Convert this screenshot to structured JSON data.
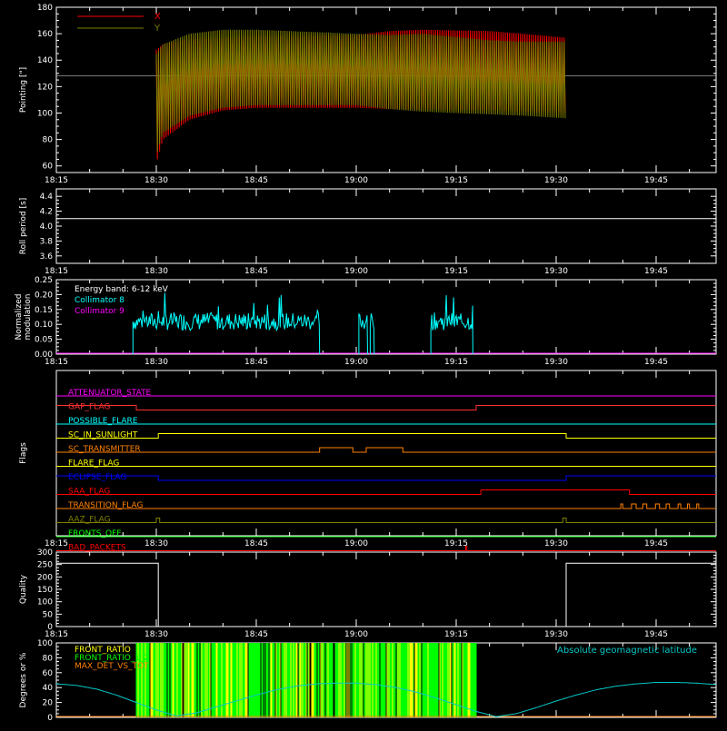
{
  "time_axis": {
    "ticks": [
      "18:15",
      "18:30",
      "18:45",
      "19:00",
      "19:15",
      "19:30",
      "19:45"
    ],
    "tick_minutes": [
      1095,
      1110,
      1125,
      1140,
      1155,
      1170,
      1185
    ],
    "range_minutes": [
      1095,
      1194
    ]
  },
  "colors": {
    "background": "#000000",
    "axes": "#ffffff",
    "x_series": "#ff0000",
    "y_series": "#808000",
    "collimator8": "#00ffff",
    "collimator9": "#ff00ff",
    "quality": "#ffffff",
    "front_ratio": "#ffff00",
    "front_ratio_2": "#00ff00",
    "max_det": "#ff8000",
    "geomag": "#00c8c8"
  },
  "chart_data": [
    {
      "type": "line",
      "id": "pointing",
      "ylabel": "Pointing [\"]",
      "ylim": [
        55,
        180
      ],
      "yticks": [
        60,
        80,
        100,
        120,
        140,
        160,
        180
      ],
      "reference_line": 128,
      "series": [
        {
          "name": "X",
          "x": [
            1110,
            1111,
            1115,
            1120,
            1125,
            1130,
            1140,
            1145,
            1150,
            1160,
            1165,
            1171.5
          ],
          "y_high": [
            148,
            152,
            156,
            157,
            158,
            158,
            159,
            162,
            163,
            162,
            160,
            157
          ],
          "y_low": [
            62,
            80,
            95,
            102,
            104,
            104,
            104,
            103,
            103,
            102,
            101,
            100
          ]
        },
        {
          "name": "Y",
          "x": [
            1110,
            1111,
            1115,
            1120,
            1125,
            1130,
            1140,
            1145,
            1150,
            1160,
            1165,
            1171.5
          ],
          "y_high": [
            145,
            152,
            160,
            163,
            163,
            162,
            160,
            159,
            160,
            155,
            154,
            154
          ],
          "y_low": [
            68,
            85,
            98,
            104,
            106,
            106,
            106,
            103,
            101,
            99,
            98,
            96
          ]
        }
      ],
      "legend": [
        "X",
        "Y"
      ],
      "legend_position": "top-left"
    },
    {
      "type": "line",
      "id": "roll",
      "ylabel": "Roll period [s]",
      "ylim": [
        3.5,
        4.5
      ],
      "yticks": [
        3.6,
        3.8,
        4.0,
        4.2,
        4.4
      ],
      "series": [
        {
          "x": [
            1095,
            1194
          ],
          "y": [
            4.1,
            4.1
          ]
        }
      ]
    },
    {
      "type": "line",
      "id": "modulation",
      "ylabel_lines": [
        "Normalized",
        "modulation"
      ],
      "ylim": [
        0,
        0.25
      ],
      "yticks": [
        0.0,
        0.05,
        0.1,
        0.15,
        0.2,
        0.25
      ],
      "annotation": "Energy band: 6-12 keV",
      "legend": [
        "Collimator 8",
        "Collimator 9"
      ],
      "segments": [
        [
          1106.5,
          1134.5
        ],
        [
          1140.4,
          1141.7
        ],
        [
          1142.1,
          1142.7
        ],
        [
          1151.2,
          1157.5
        ]
      ],
      "level": 0.11
    },
    {
      "type": "line",
      "id": "flags",
      "ylabel": "Flags",
      "rows": [
        {
          "name": "ATTENUATOR_STATE",
          "color": "#ff00ff",
          "steps": [
            [
              1095,
              0
            ]
          ]
        },
        {
          "name": "GAP_FLAG",
          "color": "#ff3030",
          "steps": [
            [
              1095,
              1
            ],
            [
              1107,
              0
            ],
            [
              1158,
              1
            ]
          ]
        },
        {
          "name": "POSSIBLE_FLARE",
          "color": "#00ffff",
          "steps": [
            [
              1095,
              0
            ]
          ]
        },
        {
          "name": "SC_IN_SUNLIGHT",
          "color": "#ffff00",
          "steps": [
            [
              1095,
              0
            ],
            [
              1110.3,
              1
            ],
            [
              1171.5,
              0
            ]
          ]
        },
        {
          "name": "SC_TRANSMITTER",
          "color": "#ff8000",
          "steps": [
            [
              1095,
              0
            ],
            [
              1134.5,
              1
            ],
            [
              1139.5,
              0
            ],
            [
              1141.5,
              1
            ],
            [
              1147,
              0
            ]
          ]
        },
        {
          "name": "FLARE_FLAG",
          "color": "#ffff00",
          "steps": [
            [
              1095,
              0
            ]
          ]
        },
        {
          "name": "ECLIPSE_FLAG",
          "color": "#0000ff",
          "steps": [
            [
              1095,
              1
            ],
            [
              1110.3,
              0
            ],
            [
              1171.5,
              1
            ]
          ]
        },
        {
          "name": "SAA_FLAG",
          "color": "#ff0000",
          "steps": [
            [
              1095,
              0
            ],
            [
              1158.7,
              1
            ],
            [
              1181,
              0
            ]
          ]
        },
        {
          "name": "TRANSITION_FLAG",
          "color": "#ff8000",
          "steps": [
            [
              1095,
              0
            ],
            [
              1179.7,
              1
            ],
            [
              1180,
              0
            ],
            [
              1181.3,
              1
            ],
            [
              1182,
              0
            ],
            [
              1183,
              1
            ],
            [
              1183.6,
              0
            ],
            [
              1184.9,
              1
            ],
            [
              1185.5,
              0
            ],
            [
              1186.5,
              1
            ],
            [
              1187,
              0
            ],
            [
              1188.3,
              1
            ],
            [
              1188.7,
              0
            ],
            [
              1189.7,
              1
            ],
            [
              1190,
              0
            ],
            [
              1191.1,
              1
            ],
            [
              1191.4,
              0
            ]
          ]
        },
        {
          "name": "AAZ_FLAG",
          "color": "#808000",
          "steps": [
            [
              1095,
              0
            ],
            [
              1110,
              1
            ],
            [
              1110.5,
              0
            ],
            [
              1171,
              1
            ],
            [
              1171.5,
              0
            ]
          ]
        },
        {
          "name": "FRONTS_OFF",
          "color": "#00ff00",
          "steps": [
            [
              1095,
              0
            ]
          ]
        },
        {
          "name": "BAD_PACKETS",
          "color": "#ff0000",
          "steps": [
            [
              1095,
              0
            ],
            [
              1156.4,
              1
            ],
            [
              1156.6,
              0
            ]
          ]
        }
      ]
    },
    {
      "type": "line",
      "id": "quality",
      "ylabel": "Quality",
      "ylim": [
        0,
        300
      ],
      "yticks": [
        0,
        50,
        100,
        150,
        200,
        250,
        300
      ],
      "series": [
        {
          "x": [
            1095,
            1110.3,
            1110.3,
            1171.5,
            1171.5,
            1194
          ],
          "y": [
            255,
            255,
            0,
            0,
            255,
            255
          ]
        }
      ]
    },
    {
      "type": "line",
      "id": "ratios",
      "ylabel": "Degrees or %",
      "ylim": [
        0,
        100
      ],
      "yticks": [
        0,
        20,
        40,
        60,
        80,
        100
      ],
      "legend": [
        "FRONT_RATIO",
        "FRONT_RATIO_1_2",
        "MAX_DET_VS_TOT"
      ],
      "legend_right": "Absolute geomagnetic latitude",
      "ratio_span": [
        1107,
        1158
      ],
      "geomag": {
        "x": [
          1095,
          1098,
          1101,
          1104,
          1107,
          1110,
          1113,
          1116,
          1119,
          1122,
          1125,
          1128,
          1131,
          1134,
          1137,
          1140,
          1143,
          1146,
          1149,
          1152,
          1155,
          1158,
          1161,
          1164,
          1167,
          1170,
          1173,
          1176,
          1179,
          1182,
          1185,
          1188,
          1191,
          1194
        ],
        "y": [
          45,
          43,
          38,
          30,
          20,
          10,
          2,
          6,
          14,
          22,
          30,
          37,
          42,
          45,
          46,
          46,
          44,
          40,
          34,
          26,
          17,
          8,
          1,
          5,
          13,
          22,
          30,
          37,
          42,
          45,
          47,
          47,
          46,
          44
        ]
      }
    }
  ]
}
